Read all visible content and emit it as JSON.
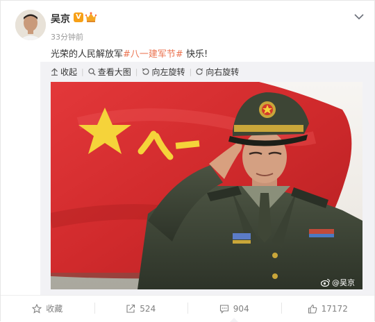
{
  "post": {
    "author": "吴京",
    "verified_badge": "V",
    "time": "33分钟前",
    "text_prefix": "光荣的人民解放军",
    "hashtag": "#八一建军节#",
    "text_suffix": " 快乐!"
  },
  "media_toolbar": {
    "collapse": "收起",
    "view_large": "查看大图",
    "rotate_left": "向左旋转",
    "rotate_right": "向右旋转"
  },
  "image": {
    "watermark": "@吴京"
  },
  "actions": {
    "favorite": "收藏",
    "repost_count": "524",
    "comment_count": "904",
    "like_count": "17172"
  },
  "colors": {
    "hashtag": "#eb7350",
    "verified": "#f7a017",
    "flag_red": "#d52b2b"
  }
}
